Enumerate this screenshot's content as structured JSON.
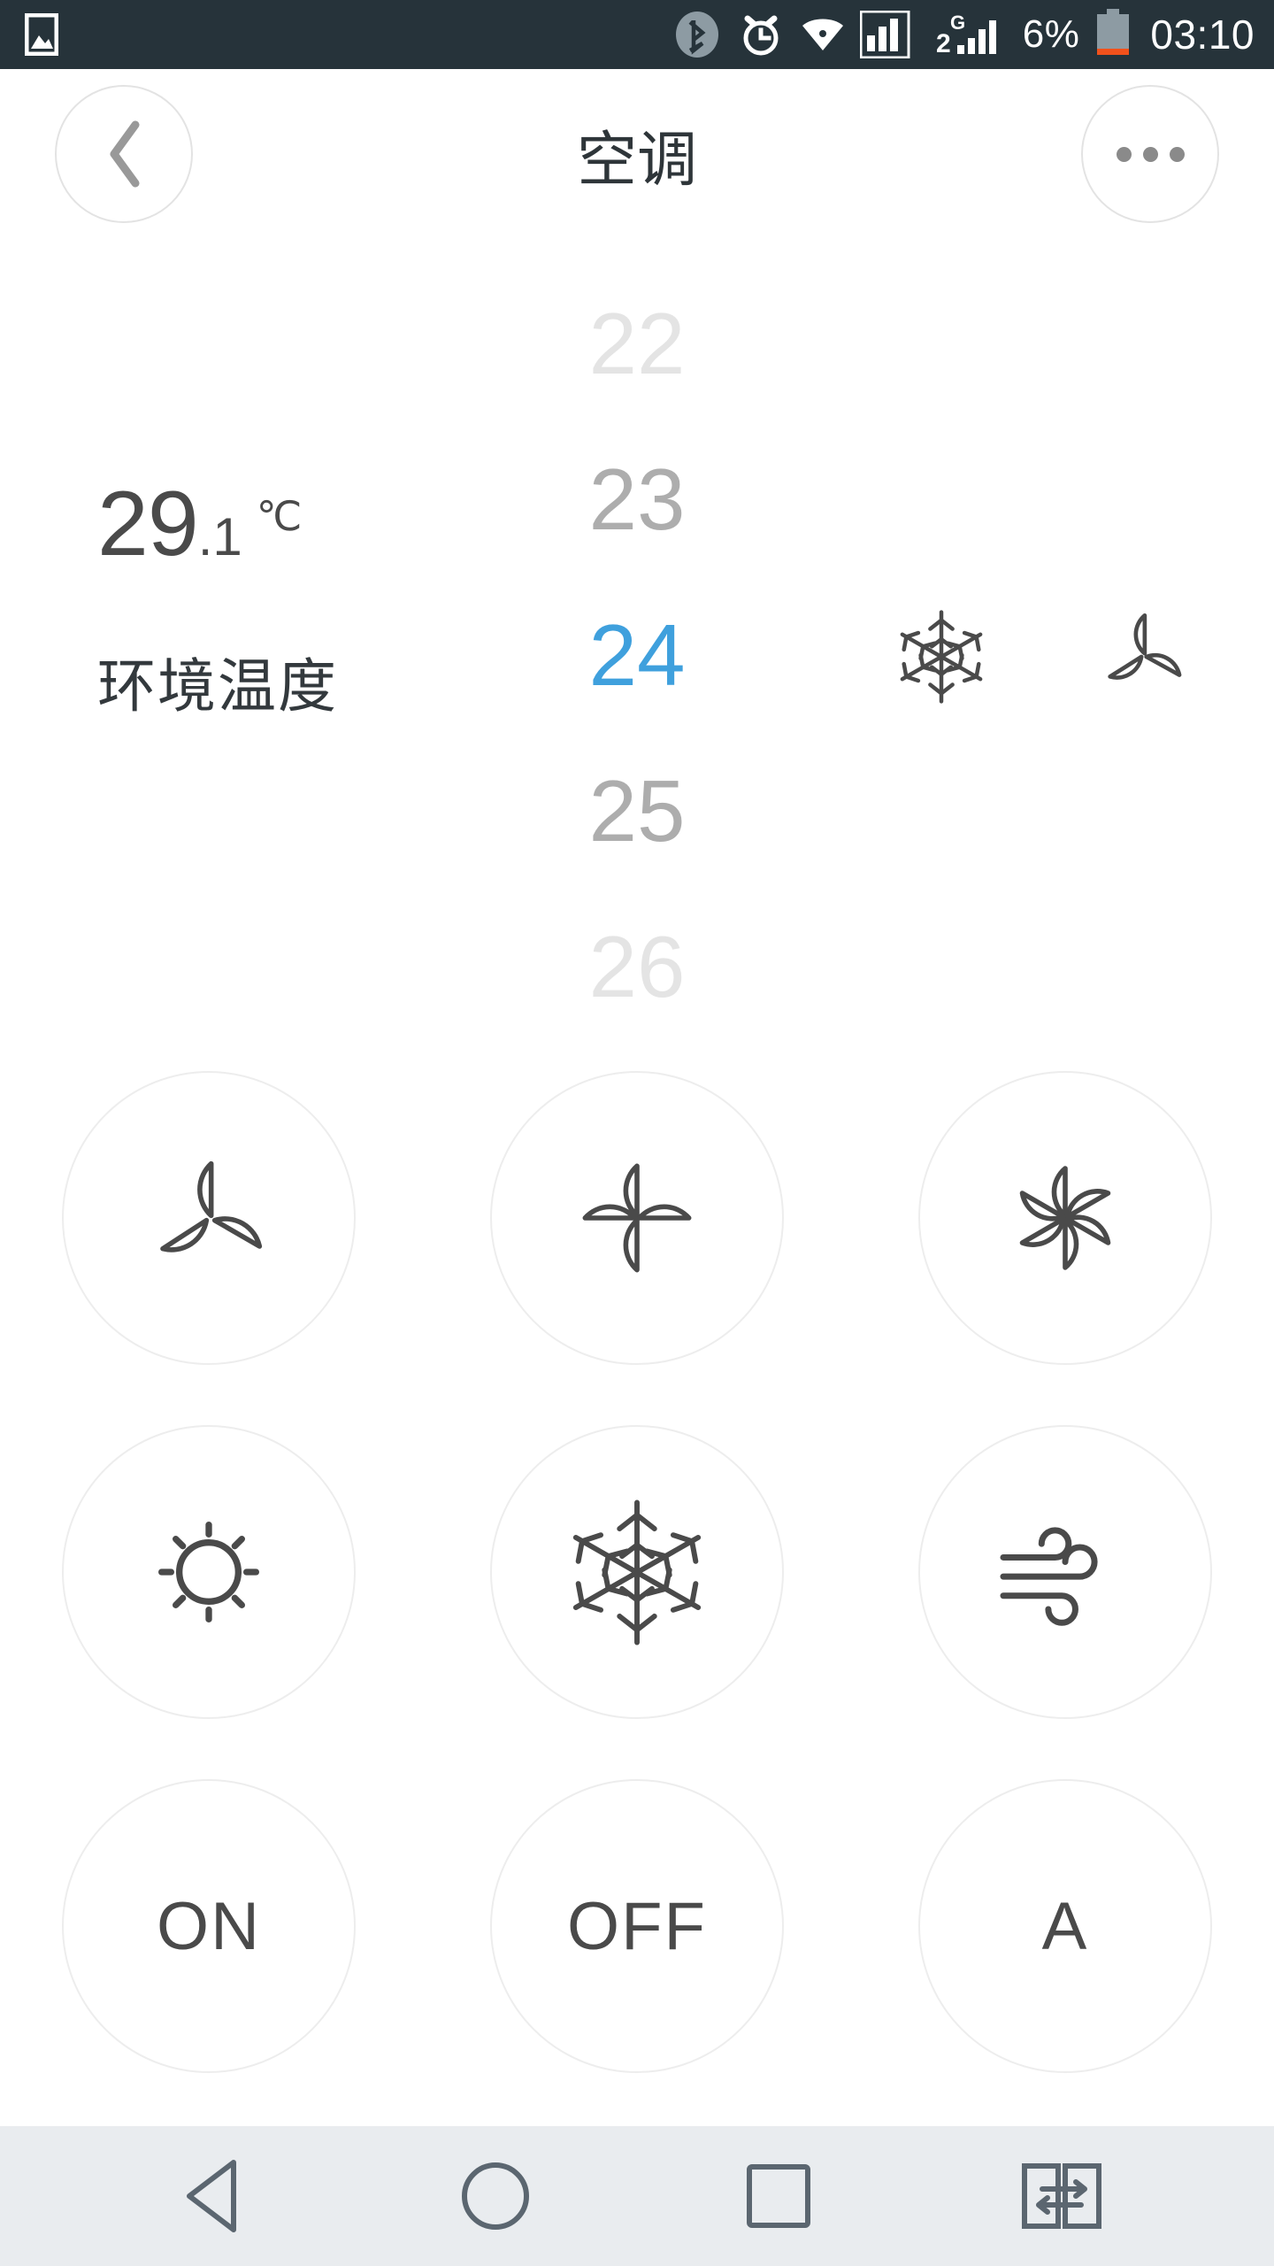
{
  "statusbar": {
    "left_icons": [
      "gallery-image-icon"
    ],
    "right_icons": [
      "bluetooth-icon",
      "alarm-clock-icon",
      "wifi-icon",
      "signal-2g-sim1-icon",
      "signal-g-sim2-icon",
      "battery-icon"
    ],
    "sim1_label": "2G",
    "sim2_label": "G",
    "battery_percent": "6%",
    "clock": "03:10",
    "bg_color": "#26333a",
    "battery_low_color": "#f2511b"
  },
  "header": {
    "title": "空调",
    "back_icon": "chevron-left-icon",
    "more_icon": "more-options-icon",
    "border_color": "#e3e3e3"
  },
  "ambient": {
    "integer": "29",
    "fraction": ".1",
    "unit": "℃",
    "label": "环境温度",
    "full_value": "29.1"
  },
  "temperature_picker": {
    "selected": "24",
    "selected_color": "#3fa0dd",
    "items": [
      {
        "value": "22",
        "state": "far"
      },
      {
        "value": "23",
        "state": "near"
      },
      {
        "value": "24",
        "state": "sel"
      },
      {
        "value": "25",
        "state": "near"
      },
      {
        "value": "26",
        "state": "far"
      }
    ]
  },
  "current_status": {
    "mode_icon": "snowflake-icon",
    "mode_label": "cool",
    "fan_icon": "fan-3-blade-icon",
    "fan_label": "low"
  },
  "controls": {
    "rows": [
      [
        {
          "name": "fan-speed-low-button",
          "icon": "fan-3-blade-icon",
          "label": ""
        },
        {
          "name": "fan-speed-medium-button",
          "icon": "fan-4-blade-icon",
          "label": ""
        },
        {
          "name": "fan-speed-high-button",
          "icon": "fan-6-blade-icon",
          "label": ""
        }
      ],
      [
        {
          "name": "mode-heat-button",
          "icon": "sun-icon",
          "label": ""
        },
        {
          "name": "mode-cool-button",
          "icon": "snowflake-icon",
          "label": ""
        },
        {
          "name": "mode-fan-button",
          "icon": "wind-icon",
          "label": ""
        }
      ],
      [
        {
          "name": "power-on-button",
          "icon": "",
          "label": "ON"
        },
        {
          "name": "power-off-button",
          "icon": "",
          "label": "OFF"
        },
        {
          "name": "mode-auto-button",
          "icon": "",
          "label": "A"
        }
      ]
    ],
    "border_color": "#ededed",
    "icon_color": "#4a4a4a"
  },
  "navbar": {
    "bg_color": "#e9ecef",
    "icon_color": "#5b6670",
    "buttons": [
      {
        "name": "nav-back-button",
        "icon": "triangle-back-icon"
      },
      {
        "name": "nav-home-button",
        "icon": "circle-home-icon"
      },
      {
        "name": "nav-recents-button",
        "icon": "square-recents-icon"
      },
      {
        "name": "nav-dual-window-button",
        "icon": "dual-window-icon"
      }
    ]
  }
}
